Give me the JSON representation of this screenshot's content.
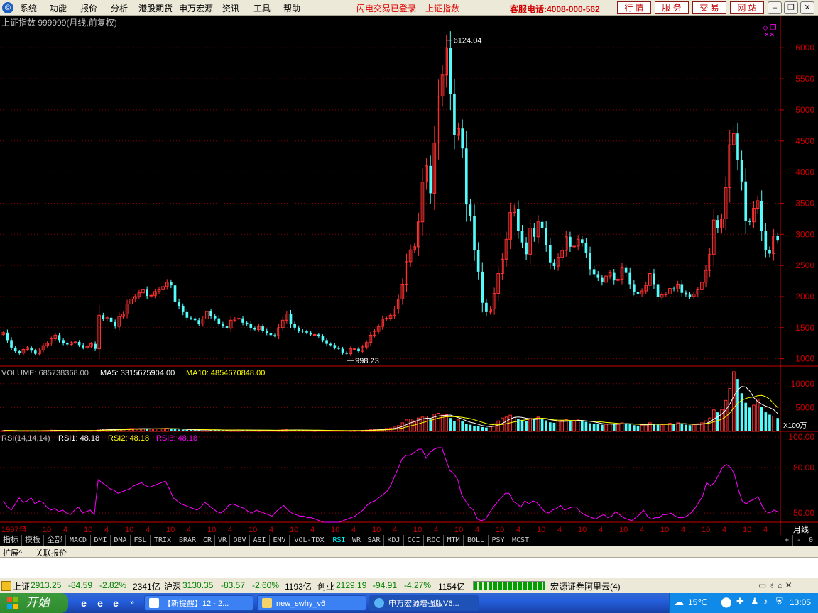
{
  "menubar": {
    "items": [
      "系统",
      "功能",
      "报价",
      "分析",
      "港股期货",
      "申万宏源",
      "资讯",
      "工具",
      "帮助"
    ],
    "status_left": "闪电交易已登录",
    "status_right": "上证指数",
    "phone": "客服电话:4008-000-562",
    "quick_buttons": [
      "行 情",
      "服 务",
      "交 易",
      "网 站"
    ]
  },
  "colors": {
    "up": "#ff3232",
    "down": "#54fcfc",
    "grid": "#8b0000",
    "axis_text": "#c80000",
    "ma5": "#ffffff",
    "ma10": "#ffff00",
    "rsi": "#ff00ff"
  },
  "chart_data": {
    "type": "candlestick",
    "title": "上证指数 999999(月线,前复权)",
    "price_axis": {
      "ticks": [
        6000,
        5500,
        5000,
        4500,
        4000,
        3500,
        3000,
        2500,
        2000,
        1500,
        1000
      ],
      "range": [
        882,
        6265
      ]
    },
    "max_label": "6124.04",
    "min_label": "998.23",
    "volume": {
      "title": "VOLUME: 685738368.00",
      "ma5_label": "MA5: 3315675904.00",
      "ma10_label": "MA10: 4854670848.00",
      "ticks": [
        10000,
        5000
      ],
      "unit": "X100万",
      "range": [
        0,
        12500
      ]
    },
    "rsi": {
      "title": "RSI(14,14,14)",
      "rsi1_label": "RSI1: 48.18",
      "rsi2_label": "RSI2: 48.18",
      "rsi3_label": "RSI3: 48.18",
      "ticks": [
        100,
        80,
        50
      ],
      "range": [
        44,
        100
      ]
    },
    "time_axis": {
      "labels": [
        "1997年",
        "4",
        "10",
        "4",
        "10",
        "4",
        "10",
        "4",
        "10",
        "4",
        "10",
        "4",
        "10",
        "4",
        "10",
        "4",
        "10",
        "4",
        "10",
        "4",
        "10",
        "4",
        "10",
        "4",
        "10",
        "4",
        "10",
        "4",
        "10",
        "4",
        "10",
        "4",
        "10",
        "4",
        "10",
        "4",
        "10",
        "4"
      ],
      "period_label": "月线"
    },
    "closes": [
      1420,
      1300,
      1180,
      1120,
      1090,
      1150,
      1180,
      1130,
      1080,
      1140,
      1210,
      1250,
      1320,
      1380,
      1300,
      1250,
      1230,
      1260,
      1270,
      1220,
      1180,
      1200,
      1240,
      1160,
      1700,
      1640,
      1660,
      1590,
      1520,
      1680,
      1720,
      1880,
      1960,
      2000,
      2060,
      2110,
      2010,
      2020,
      2080,
      2110,
      2160,
      2230,
      2180,
      1920,
      1840,
      1750,
      1660,
      1650,
      1620,
      1560,
      1640,
      1760,
      1690,
      1650,
      1560,
      1520,
      1490,
      1620,
      1640,
      1650,
      1580,
      1560,
      1490,
      1470,
      1520,
      1450,
      1410,
      1380,
      1370,
      1500,
      1620,
      1720,
      1560,
      1500,
      1450,
      1440,
      1420,
      1390,
      1390,
      1360,
      1300,
      1240,
      1220,
      1180,
      1160,
      1100,
      1080,
      1160,
      1160,
      1120,
      1190,
      1260,
      1380,
      1440,
      1520,
      1640,
      1650,
      1700,
      1800,
      1960,
      2200,
      2560,
      2750,
      2800,
      3200,
      3840,
      4100,
      3660,
      4470,
      5220,
      5560,
      6000,
      5260,
      4600,
      4700,
      4380,
      3480,
      3300,
      2750,
      2400,
      1900,
      1750,
      1800,
      2050,
      2370,
      2600,
      2920,
      3350,
      3410,
      3060,
      2870,
      2680,
      3100,
      2960,
      3200,
      3100,
      2830,
      2550,
      2490,
      2630,
      2740,
      2960,
      2800,
      2810,
      2920,
      2860,
      2700,
      2440,
      2360,
      2300,
      2230,
      2330,
      2380,
      2260,
      2280,
      2460,
      2380,
      2200,
      2080,
      2040,
      2090,
      2180,
      2370,
      2200,
      1990,
      2030,
      2040,
      2130,
      2120,
      2200,
      2060,
      2030,
      2000,
      2040,
      2110,
      2230,
      2420,
      2680,
      3230,
      3100,
      3250,
      3750,
      4440,
      4620,
      4200,
      3850,
      3210,
      3200,
      3420,
      3540,
      3060,
      2750,
      2690,
      2970,
      2910
    ],
    "volumes": [
      200,
      180,
      150,
      130,
      120,
      150,
      140,
      120,
      110,
      140,
      180,
      200,
      260,
      240,
      220,
      180,
      170,
      190,
      180,
      160,
      150,
      160,
      180,
      200,
      500,
      420,
      380,
      340,
      330,
      400,
      450,
      550,
      620,
      600,
      580,
      560,
      520,
      500,
      540,
      560,
      600,
      650,
      560,
      450,
      400,
      350,
      320,
      300,
      280,
      260,
      300,
      380,
      340,
      300,
      260,
      240,
      230,
      280,
      300,
      310,
      280,
      260,
      240,
      230,
      250,
      240,
      220,
      200,
      210,
      260,
      320,
      360,
      300,
      260,
      240,
      230,
      220,
      210,
      200,
      190,
      180,
      170,
      160,
      150,
      150,
      140,
      140,
      180,
      200,
      190,
      220,
      260,
      340,
      380,
      420,
      520,
      600,
      700,
      900,
      1200,
      1800,
      2400,
      2600,
      2200,
      2800,
      3000,
      3200,
      2500,
      3600,
      3800,
      3400,
      3500,
      2800,
      2200,
      2400,
      2100,
      1500,
      1400,
      1200,
      1100,
      900,
      800,
      1000,
      1600,
      2200,
      2800,
      3000,
      3400,
      3200,
      2600,
      2400,
      2200,
      2700,
      2500,
      3000,
      2600,
      2300,
      1900,
      1800,
      2100,
      2300,
      2500,
      2100,
      2200,
      2400,
      2300,
      2000,
      1700,
      1600,
      1500,
      1400,
      1500,
      1600,
      1500,
      1500,
      1800,
      1700,
      1500,
      1300,
      1200,
      1300,
      1500,
      1800,
      1600,
      1400,
      1400,
      1500,
      1700,
      1600,
      1800,
      1500,
      1400,
      1300,
      1400,
      1600,
      1800,
      2200,
      2800,
      4500,
      4000,
      4600,
      6500,
      9000,
      12500,
      11000,
      8000,
      6000,
      5000,
      5500,
      6800,
      5200,
      4000,
      3500,
      3200,
      2800
    ],
    "rsi1": [
      58,
      54,
      52,
      56,
      60,
      57,
      58,
      60,
      56,
      58,
      57,
      54,
      52,
      53,
      51,
      52,
      50,
      49,
      52,
      54,
      50,
      51,
      52,
      49,
      72,
      70,
      68,
      66,
      65,
      63,
      64,
      65,
      66,
      68,
      69,
      70,
      68,
      67,
      68,
      69,
      70,
      71,
      66,
      60,
      58,
      56,
      55,
      54,
      53,
      52,
      54,
      57,
      55,
      53,
      51,
      50,
      52,
      55,
      56,
      55,
      54,
      53,
      51,
      50,
      52,
      51,
      50,
      49,
      48,
      51,
      53,
      55,
      52,
      50,
      49,
      48,
      48,
      47,
      47,
      46,
      45,
      44,
      44,
      44,
      44,
      44,
      45,
      46,
      47,
      48,
      50,
      52,
      55,
      57,
      58,
      60,
      62,
      64,
      68,
      74,
      80,
      86,
      88,
      88,
      90,
      92,
      92,
      86,
      90,
      92,
      93,
      93,
      85,
      78,
      76,
      72,
      62,
      58,
      54,
      52,
      46,
      45,
      46,
      50,
      54,
      57,
      60,
      63,
      63,
      58,
      56,
      54,
      58,
      56,
      58,
      57,
      54,
      51,
      50,
      52,
      53,
      55,
      52,
      53,
      54,
      54,
      51,
      49,
      48,
      47,
      46,
      48,
      49,
      47,
      48,
      51,
      49,
      47,
      46,
      45,
      47,
      49,
      52,
      48,
      46,
      47,
      47,
      49,
      49,
      50,
      48,
      47,
      47,
      48,
      50,
      53,
      57,
      61,
      70,
      68,
      70,
      75,
      80,
      82,
      80,
      76,
      66,
      58,
      56,
      58,
      59,
      61,
      55,
      51,
      50,
      52,
      51
    ]
  },
  "tabs": [
    "指标",
    "模板",
    "全部",
    "MACD",
    "DMI",
    "DMA",
    "FSL",
    "TRIX",
    "BRAR",
    "CR",
    "VR",
    "OBV",
    "ASI",
    "EMV",
    "VOL-TDX",
    "RSI",
    "WR",
    "SAR",
    "KDJ",
    "CCI",
    "ROC",
    "MTM",
    "BOLL",
    "PSY",
    "MCST"
  ],
  "tab_controls": [
    "+",
    "-",
    "0"
  ],
  "ext": {
    "item1": "扩展^",
    "item2": "关联报价"
  },
  "status": {
    "sh_name": "上证",
    "sh_val": "2913.25",
    "sh_chg": "-84.59",
    "sh_pct": "-2.82%",
    "sh_amt": "2341亿",
    "sz_name": "沪深",
    "sz_val": "3130.35",
    "sz_chg": "-83.57",
    "sz_pct": "-2.60%",
    "sz_amt": "1193亿",
    "cy_name": "创业",
    "cy_val": "2129.19",
    "cy_chg": "-94.91",
    "cy_pct": "-4.27%",
    "cy_amt": "1154亿",
    "broker": "宏源证券阿里云(4)"
  },
  "taskbar": {
    "start": "开始",
    "tasks": [
      "【新提醒】12 - 2...",
      "new_swhy_v6",
      "申万宏源增强版V6..."
    ],
    "temp": "15℃",
    "time": "13:05"
  }
}
